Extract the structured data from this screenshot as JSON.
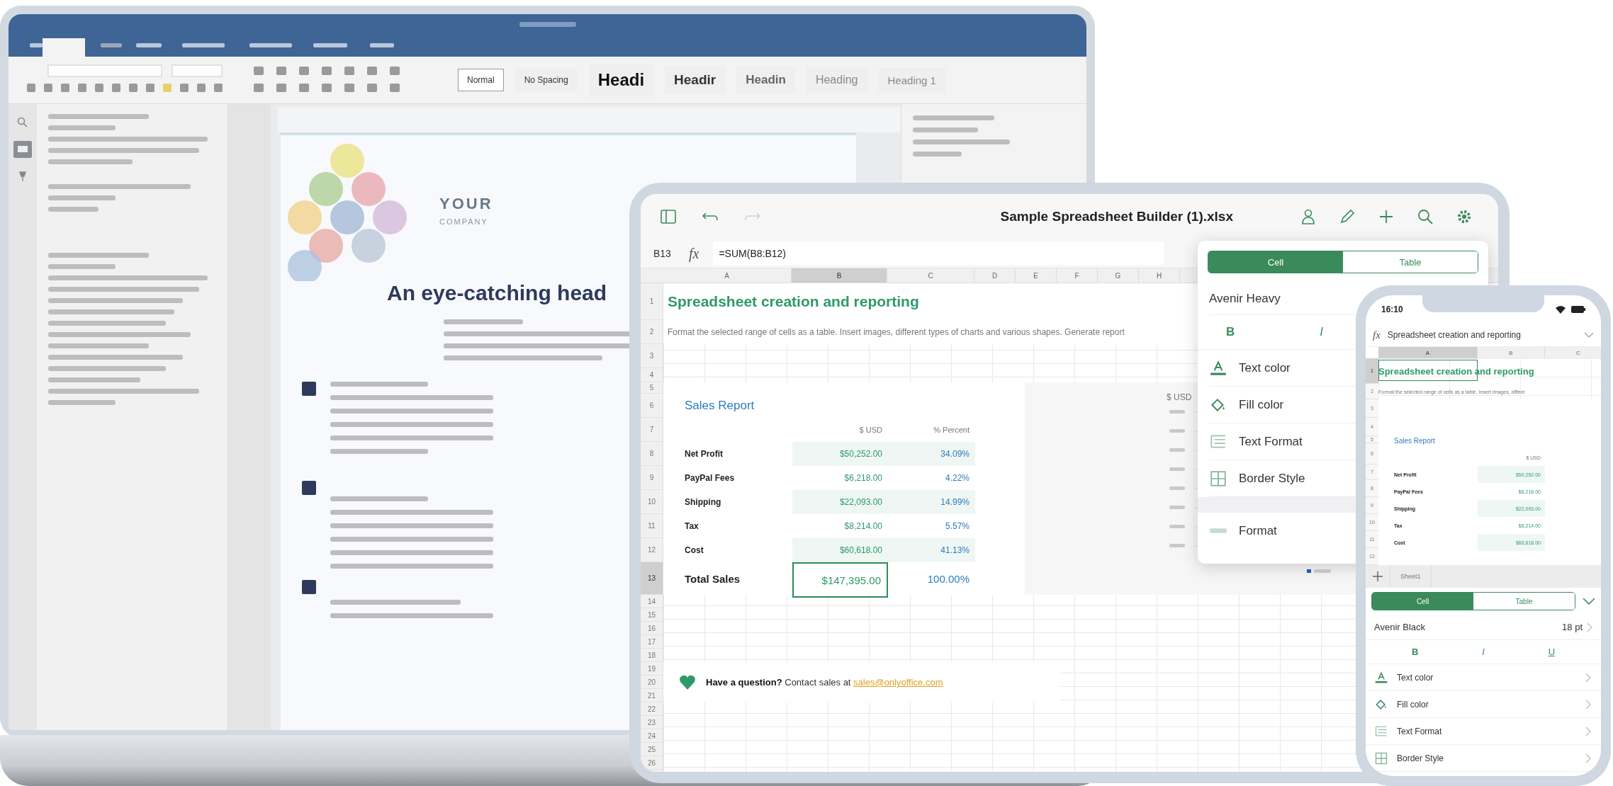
{
  "laptop": {
    "style_gallery": [
      {
        "label": "Normal",
        "selected": true
      },
      {
        "label": "No Spacing",
        "selected": false
      },
      {
        "label": "Headi",
        "selected": false
      },
      {
        "label": "Headir",
        "selected": false
      },
      {
        "label": "Headin",
        "selected": false
      },
      {
        "label": "Heading",
        "selected": false
      },
      {
        "label": "Heading 1",
        "selected": false
      }
    ],
    "document": {
      "company": "YOUR",
      "company_subtitle": "COMPANY",
      "headline": "An eye-catching head"
    }
  },
  "tablet": {
    "title": "Sample Spreadsheet Builder (1).xlsx",
    "cell_ref": "B13",
    "function_label": "fx",
    "formula": "=SUM(B8:B12)",
    "columns": [
      {
        "label": "A",
        "selected": false
      },
      {
        "label": "B",
        "selected": true
      },
      {
        "label": "C",
        "selected": false
      },
      {
        "label": "D",
        "selected": false
      },
      {
        "label": "E",
        "selected": false
      },
      {
        "label": "F",
        "selected": false
      },
      {
        "label": "G",
        "selected": false
      },
      {
        "label": "H",
        "selected": false
      }
    ],
    "rows": [
      {
        "label": "1",
        "selected": false
      },
      {
        "label": "2",
        "selected": false
      },
      {
        "label": "3",
        "selected": false
      },
      {
        "label": "4",
        "selected": false
      },
      {
        "label": "5",
        "selected": false
      },
      {
        "label": "6",
        "selected": false
      },
      {
        "label": "7",
        "selected": false
      },
      {
        "label": "8",
        "selected": false
      },
      {
        "label": "9",
        "selected": false
      },
      {
        "label": "10",
        "selected": false
      },
      {
        "label": "11",
        "selected": false
      },
      {
        "label": "12",
        "selected": false
      },
      {
        "label": "13",
        "selected": true
      },
      {
        "label": "14",
        "selected": false
      },
      {
        "label": "15",
        "selected": false
      },
      {
        "label": "16",
        "selected": false
      },
      {
        "label": "17",
        "selected": false
      },
      {
        "label": "18",
        "selected": false
      },
      {
        "label": "19",
        "selected": false
      },
      {
        "label": "20",
        "selected": false
      },
      {
        "label": "21",
        "selected": false
      },
      {
        "label": "22",
        "selected": false
      },
      {
        "label": "23",
        "selected": false
      },
      {
        "label": "24",
        "selected": false
      },
      {
        "label": "25",
        "selected": false
      },
      {
        "label": "26",
        "selected": false
      }
    ],
    "heading": "Spreadsheet creation and reporting",
    "description": "Format the selected range of cells as a table. Insert images, different types of charts and various shapes. Generate report",
    "report": {
      "title": "Sales Report",
      "headers": [
        "$ USD",
        "% Percent"
      ],
      "rows": [
        {
          "label": "Net Profit",
          "amount": "$50,252.00",
          "percent": "34.09%"
        },
        {
          "label": "PayPal Fees",
          "amount": "$6,218.00",
          "percent": "4.22%"
        },
        {
          "label": "Shipping",
          "amount": "$22,093.00",
          "percent": "14.99%"
        },
        {
          "label": "Tax",
          "amount": "$8,214.00",
          "percent": "5.57%"
        },
        {
          "label": "Cost",
          "amount": "$60,618.00",
          "percent": "41.13%"
        }
      ],
      "total": {
        "label": "Total Sales",
        "amount": "$147,395.00",
        "percent": "100.00%"
      }
    },
    "chart": {
      "label": "$ USD"
    },
    "contact": {
      "text": "**Have a question?** Contact sales at",
      "link": "sales@onlyoffice.com"
    },
    "format_panel": {
      "tabs": [
        {
          "label": "Cell",
          "selected": true
        },
        {
          "label": "Table",
          "selected": false
        }
      ],
      "font": "Avenir Heavy",
      "styles": [
        "B",
        "I"
      ],
      "items": [
        {
          "kind": "text-color",
          "label": "Text color"
        },
        {
          "kind": "fill-color",
          "label": "Fill color"
        },
        {
          "kind": "text-format",
          "label": "Text Format"
        },
        {
          "kind": "border-style",
          "label": "Border Style"
        }
      ],
      "format_section": {
        "kind": "number-format",
        "label": "Format"
      }
    }
  },
  "phone": {
    "time": "16:10",
    "function_label": "fx",
    "formula": "Spreadsheet creation and reporting",
    "columns": [
      {
        "label": "A",
        "selected": true
      },
      {
        "label": "B",
        "selected": false
      },
      {
        "label": "C",
        "selected": false
      }
    ],
    "rows": [
      {
        "label": "1",
        "selected": true
      },
      {
        "label": "2",
        "selected": false
      },
      {
        "label": "3",
        "selected": false
      },
      {
        "label": "4",
        "selected": false
      },
      {
        "label": "5",
        "selected": false
      },
      {
        "label": "6",
        "selected": false
      },
      {
        "label": "7",
        "selected": false
      },
      {
        "label": "8",
        "selected": false
      },
      {
        "label": "9",
        "selected": false
      },
      {
        "label": "10",
        "selected": false
      },
      {
        "label": "11",
        "selected": false
      },
      {
        "label": "12",
        "selected": false
      }
    ],
    "heading": "Spreadsheet creation and reporting",
    "description": "Format the selected range of cells as a table. Insert images, differe",
    "report": {
      "title": "Sales Report",
      "header": "$ USD",
      "rows": [
        {
          "label": "Net Profit",
          "amount": "$50,252.00"
        },
        {
          "label": "PayPal Fees",
          "amount": "$6,218.00"
        },
        {
          "label": "Shipping",
          "amount": "$22,093.00"
        },
        {
          "label": "Tax",
          "amount": "$8,214.00"
        },
        {
          "label": "Cost",
          "amount": "$60,618.00"
        }
      ]
    },
    "sheet_tab": "Sheet1",
    "format_panel": {
      "tabs": [
        {
          "label": "Cell",
          "selected": true
        },
        {
          "label": "Table",
          "selected": false
        }
      ],
      "font": "Avenir Black",
      "size": "18 pt",
      "styles": [
        "B",
        "I",
        "U"
      ],
      "items": [
        {
          "kind": "text-color",
          "label": "Text color"
        },
        {
          "kind": "fill-color",
          "label": "Fill color"
        },
        {
          "kind": "text-format",
          "label": "Text Format"
        },
        {
          "kind": "border-style",
          "label": "Border Style"
        }
      ]
    }
  }
}
